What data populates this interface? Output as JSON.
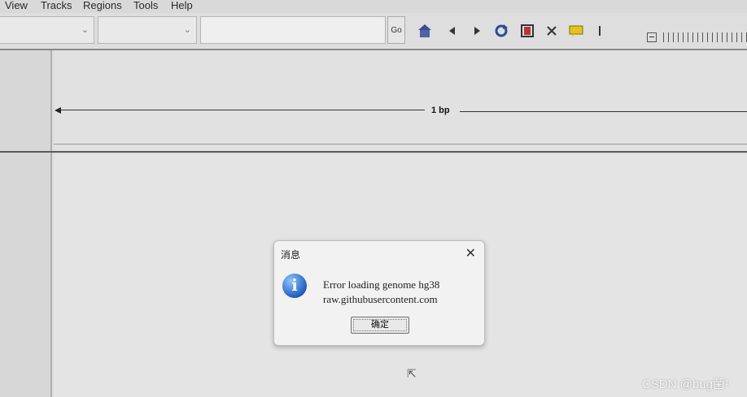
{
  "menu": [
    "View",
    "Tracks",
    "Regions",
    "Tools",
    "Help"
  ],
  "toolbar": {
    "genome_select_value": "",
    "chromosome_select_value": "",
    "locus_value": "",
    "go_label": "Go",
    "icons": [
      "home-icon",
      "back-icon",
      "forward-icon",
      "refresh-icon",
      "resize-icon",
      "region-icon",
      "popup-icon",
      "roi-icon"
    ]
  },
  "ruler": {
    "label": "1 bp"
  },
  "dialog": {
    "title": "消息",
    "close": "✕",
    "line1": "Error loading genome hg38",
    "line2": "raw.githubusercontent.com",
    "ok_label": "确定"
  },
  "watermark": "CSDN @bug菌¹"
}
